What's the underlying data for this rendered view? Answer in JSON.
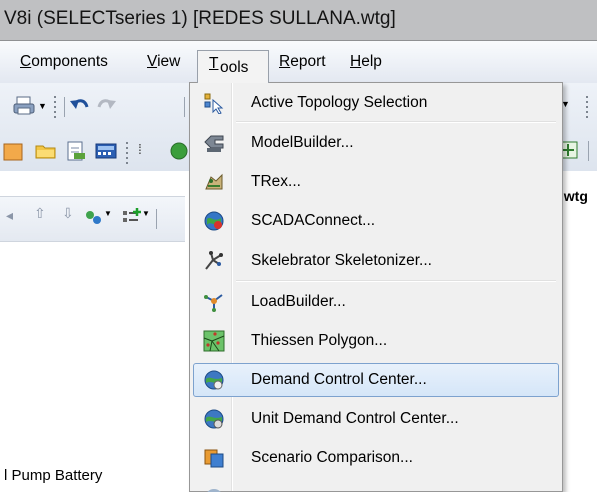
{
  "window": {
    "title": "V8i (SELECTseries 1) [REDES SULLANA.wtg]"
  },
  "menu_bar": {
    "items": [
      {
        "label": "Components",
        "mnemonic": "C"
      },
      {
        "label": "View",
        "mnemonic": "V"
      },
      {
        "label": "Tools",
        "mnemonic": "T"
      },
      {
        "label": "Report",
        "mnemonic": "R"
      },
      {
        "label": "Help",
        "mnemonic": "H"
      }
    ]
  },
  "tools_menu": {
    "items": [
      {
        "label": "Active Topology Selection",
        "icon": "topology-selection-icon"
      },
      {
        "label": "ModelBuilder...",
        "icon": "modelbuilder-icon"
      },
      {
        "label": "TRex...",
        "icon": "trex-icon"
      },
      {
        "label": "SCADAConnect...",
        "icon": "scadaconnect-icon"
      },
      {
        "label": "Skelebrator Skeletonizer...",
        "icon": "skelebrator-icon"
      },
      {
        "label": "LoadBuilder...",
        "icon": "loadbuilder-icon"
      },
      {
        "label": "Thiessen Polygon...",
        "icon": "thiessen-polygon-icon"
      },
      {
        "label": "Demand Control Center...",
        "icon": "demand-control-center-icon",
        "highlighted": true
      },
      {
        "label": "Unit Demand Control Center...",
        "icon": "unit-demand-control-center-icon"
      },
      {
        "label": "Scenario Comparison...",
        "icon": "scenario-comparison-icon"
      }
    ]
  },
  "document_tab": {
    "label": "\\.wtg"
  },
  "left_panel": {
    "item_text": "l Pump Battery"
  },
  "colors": {
    "highlight_fill": "#dbe9f9",
    "highlight_border": "#7da2ce",
    "menu_background": "#f0f0f0",
    "title_bar": "#bfc0c2"
  }
}
